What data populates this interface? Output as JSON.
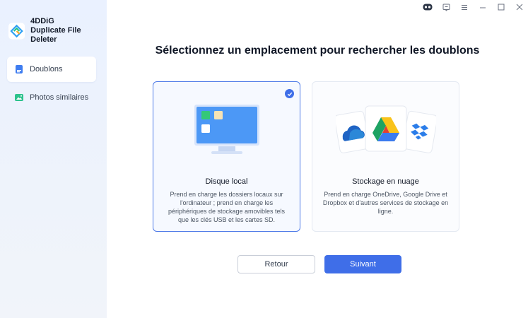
{
  "brand": {
    "name_line1": "4DDiG",
    "name_line2": "Duplicate File Deleter"
  },
  "sidebar": {
    "items": [
      {
        "label": "Doublons",
        "icon": "document-icon",
        "active": true
      },
      {
        "label": "Photos similaires",
        "icon": "image-icon",
        "active": false
      }
    ]
  },
  "window_controls": [
    "assistant-icon",
    "feedback-icon",
    "menu-icon",
    "minimize-icon",
    "maximize-icon",
    "close-icon"
  ],
  "main": {
    "title": "Sélectionnez un emplacement pour rechercher les doublons",
    "cards": [
      {
        "title": "Disque local",
        "description": "Prend en charge les dossiers locaux sur l'ordinateur ; prend en charge les périphériques de stockage amovibles tels que les clés USB et les cartes SD.",
        "selected": true
      },
      {
        "title": "Stockage en nuage",
        "description": "Prend en charge OneDrive, Google Drive et Dropbox et d'autres services de stockage en ligne.",
        "selected": false
      }
    ],
    "back_label": "Retour",
    "next_label": "Suivant"
  },
  "colors": {
    "accent": "#3f6ee8",
    "sidebar_bg": "#eaf1ff"
  }
}
